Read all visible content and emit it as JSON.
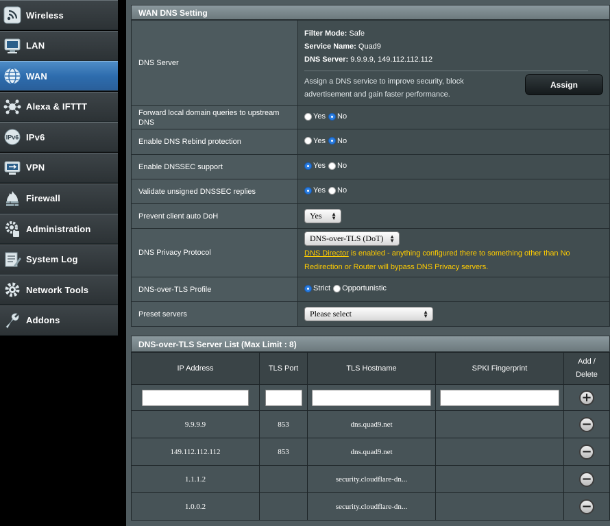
{
  "sidebar": {
    "items": [
      {
        "label": "Wireless",
        "icon": "wireless-icon"
      },
      {
        "label": "LAN",
        "icon": "lan-icon"
      },
      {
        "label": "WAN",
        "icon": "globe-icon",
        "active": true
      },
      {
        "label": "Alexa & IFTTT",
        "icon": "alexa-icon"
      },
      {
        "label": "IPv6",
        "icon": "ipv6-icon"
      },
      {
        "label": "VPN",
        "icon": "vpn-icon"
      },
      {
        "label": "Firewall",
        "icon": "firewall-icon"
      },
      {
        "label": "Administration",
        "icon": "admin-icon"
      },
      {
        "label": "System Log",
        "icon": "system-log-icon"
      },
      {
        "label": "Network Tools",
        "icon": "network-tools-icon"
      },
      {
        "label": "Addons",
        "icon": "addons-icon"
      }
    ]
  },
  "wan_dns": {
    "title": "WAN DNS Setting",
    "dns_server": {
      "label": "DNS Server",
      "filter_mode_key": "Filter Mode:",
      "filter_mode_val": "Safe",
      "service_name_key": "Service Name:",
      "service_name_val": "Quad9",
      "dns_server_key": "DNS Server:",
      "dns_server_val": "9.9.9.9, 149.112.112.112",
      "assign_desc_1": "Assign a DNS service to improve security, block",
      "assign_desc_2": "advertisement and gain faster performance.",
      "assign_button": "Assign"
    },
    "forward_local": {
      "label_1": "Forward local domain queries to upstream",
      "label_2": "DNS",
      "yes": "Yes",
      "no": "No",
      "value": "No"
    },
    "rebind": {
      "label": "Enable DNS Rebind protection",
      "yes": "Yes",
      "no": "No",
      "value": "No"
    },
    "dnssec": {
      "label": "Enable DNSSEC support",
      "yes": "Yes",
      "no": "No",
      "value": "Yes"
    },
    "validate": {
      "label": "Validate unsigned DNSSEC replies",
      "yes": "Yes",
      "no": "No",
      "value": "Yes"
    },
    "doh": {
      "label": "Prevent client auto DoH",
      "value": "Yes"
    },
    "privacy": {
      "label": "DNS Privacy Protocol",
      "value": "DNS-over-TLS (DoT)",
      "warn_link": "DNS Director",
      "warn_1": " is enabled - anything configured there to something other than No",
      "warn_2": "Redirection or Router will bypass DNS Privacy servers."
    },
    "dot_profile": {
      "label": "DNS-over-TLS Profile",
      "strict": "Strict",
      "opportunistic": "Opportunistic",
      "value": "Strict"
    },
    "preset": {
      "label": "Preset servers",
      "value": "Please select"
    }
  },
  "server_list": {
    "title": "DNS-over-TLS Server List (Max Limit : 8)",
    "headers": {
      "ip": "IP Address",
      "port": "TLS Port",
      "host": "TLS Hostname",
      "spki": "SPKI Fingerprint",
      "add_1": "Add /",
      "add_2": "Delete"
    },
    "rows": [
      {
        "ip": "9.9.9.9",
        "port": "853",
        "host": "dns.quad9.net",
        "spki": ""
      },
      {
        "ip": "149.112.112.112",
        "port": "853",
        "host": "dns.quad9.net",
        "spki": ""
      },
      {
        "ip": "1.1.1.2",
        "port": "",
        "host": "security.cloudflare-dn...",
        "spki": ""
      },
      {
        "ip": "1.0.0.2",
        "port": "",
        "host": "security.cloudflare-dn...",
        "spki": ""
      }
    ]
  }
}
